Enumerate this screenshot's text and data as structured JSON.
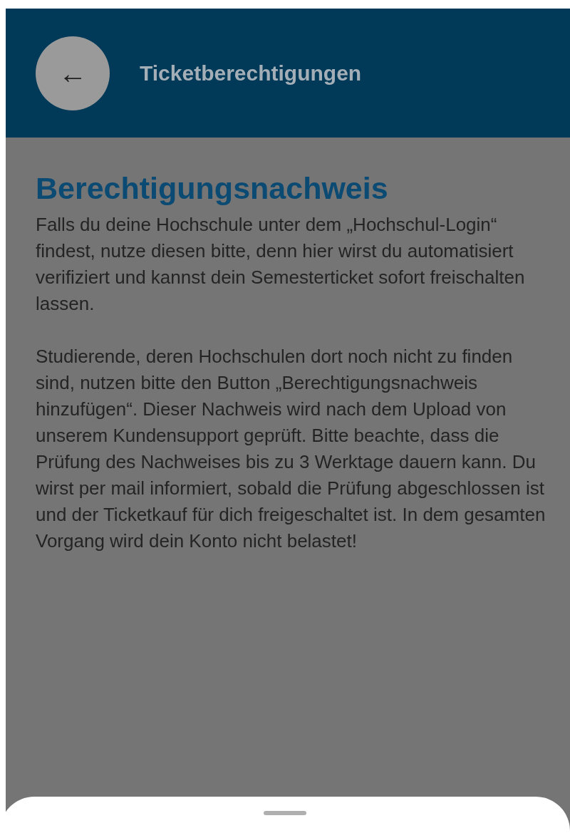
{
  "header": {
    "back_button": "←",
    "title": "Ticketberechtigungen"
  },
  "content": {
    "heading": "Berechtigungsnachweis",
    "paragraphs": [
      "Falls du deine Hochschule unter dem „Hochschul-Login“ findest, nutze diesen bitte, denn hier wirst du automatisiert verifiziert und kannst dein Semesterticket sofort freischalten lassen.",
      "Studierende, deren Hochschulen dort noch nicht zu finden sind, nutzen bitte den Button „Berechtigungsnachweis hinzufügen“. Dieser Nachweis wird nach dem Upload von unserem Kundensupport geprüft. Bitte beachte, dass die Prüfung des Nachweises bis zu 3 Werktage dauern kann. Du wirst per mail informiert, sobald die Prüfung abgeschlossen ist und der Ticketkauf für dich freigeschaltet ist. In dem gesamten Vorgang wird dein Konto nicht belastet!"
    ]
  }
}
